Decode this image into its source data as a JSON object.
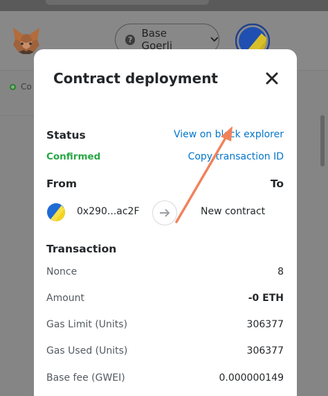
{
  "header": {
    "network_name": "Base Goerli",
    "network_help_glyph": "?",
    "status_truncated": "Co"
  },
  "modal": {
    "title": "Contract deployment",
    "status_heading": "Status",
    "status_value": "Confirmed",
    "view_explorer_link": "View on block explorer",
    "copy_tx_link": "Copy transaction ID",
    "from_heading": "From",
    "to_heading": "To",
    "from_address": "0x290...ac2F",
    "to_value": "New contract",
    "transaction_heading": "Transaction",
    "rows": [
      {
        "label": "Nonce",
        "value": "8"
      },
      {
        "label": "Amount",
        "value": "-0 ETH"
      },
      {
        "label": "Gas Limit (Units)",
        "value": "306377"
      },
      {
        "label": "Gas Used (Units)",
        "value": "306377"
      },
      {
        "label": "Base fee (GWEI)",
        "value": "0.000000149"
      }
    ]
  },
  "colors": {
    "link": "#0376c9",
    "confirmed": "#28a745",
    "annotation_arrow": "#f0825a",
    "overlay": "#858585"
  },
  "icons": {
    "logo": "metamask-fox-icon",
    "network_help": "question-icon",
    "chevron": "chevron-down-icon",
    "close": "close-icon",
    "arrow": "arrow-right-icon",
    "status_dot": "status-dot-icon"
  }
}
